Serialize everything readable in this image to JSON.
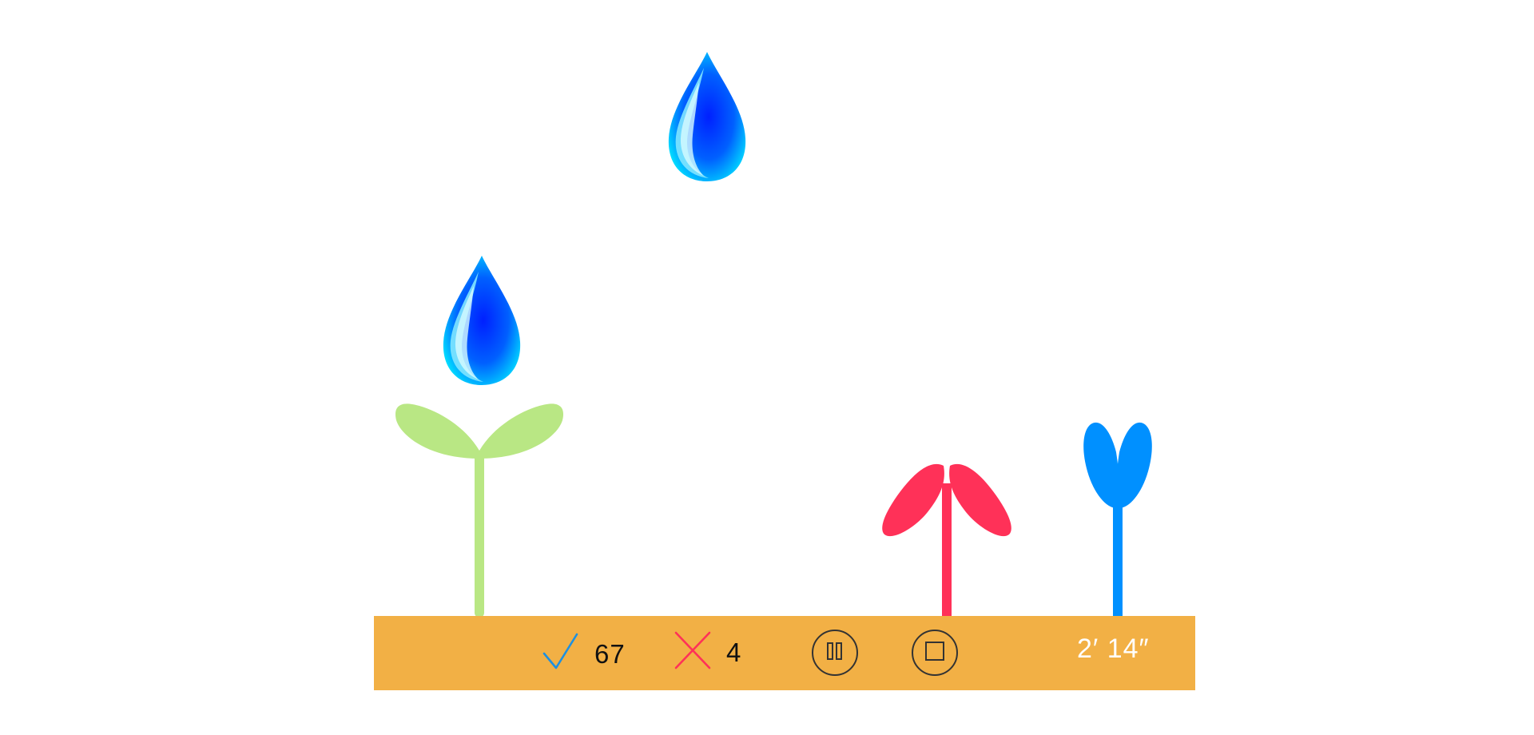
{
  "hud": {
    "correct_count": "67",
    "wrong_count": "4",
    "timer": "2′ 14″",
    "correct_icon": "checkmark-icon",
    "wrong_icon": "cross-icon",
    "pause_icon": "pause-icon",
    "stop_icon": "stop-icon"
  },
  "scene": {
    "drops": [
      "water-drop",
      "water-drop"
    ],
    "plants": [
      {
        "name": "green-sprout",
        "color": "#b9e784"
      },
      {
        "name": "red-sprout",
        "color": "#ff3158"
      },
      {
        "name": "blue-sprout",
        "color": "#0090ff"
      }
    ]
  },
  "colors": {
    "ground": "#f2b045",
    "correct": "#1e90e0",
    "wrong": "#ff3158",
    "timer_text": "#ffffff",
    "background": "#ffffff"
  }
}
